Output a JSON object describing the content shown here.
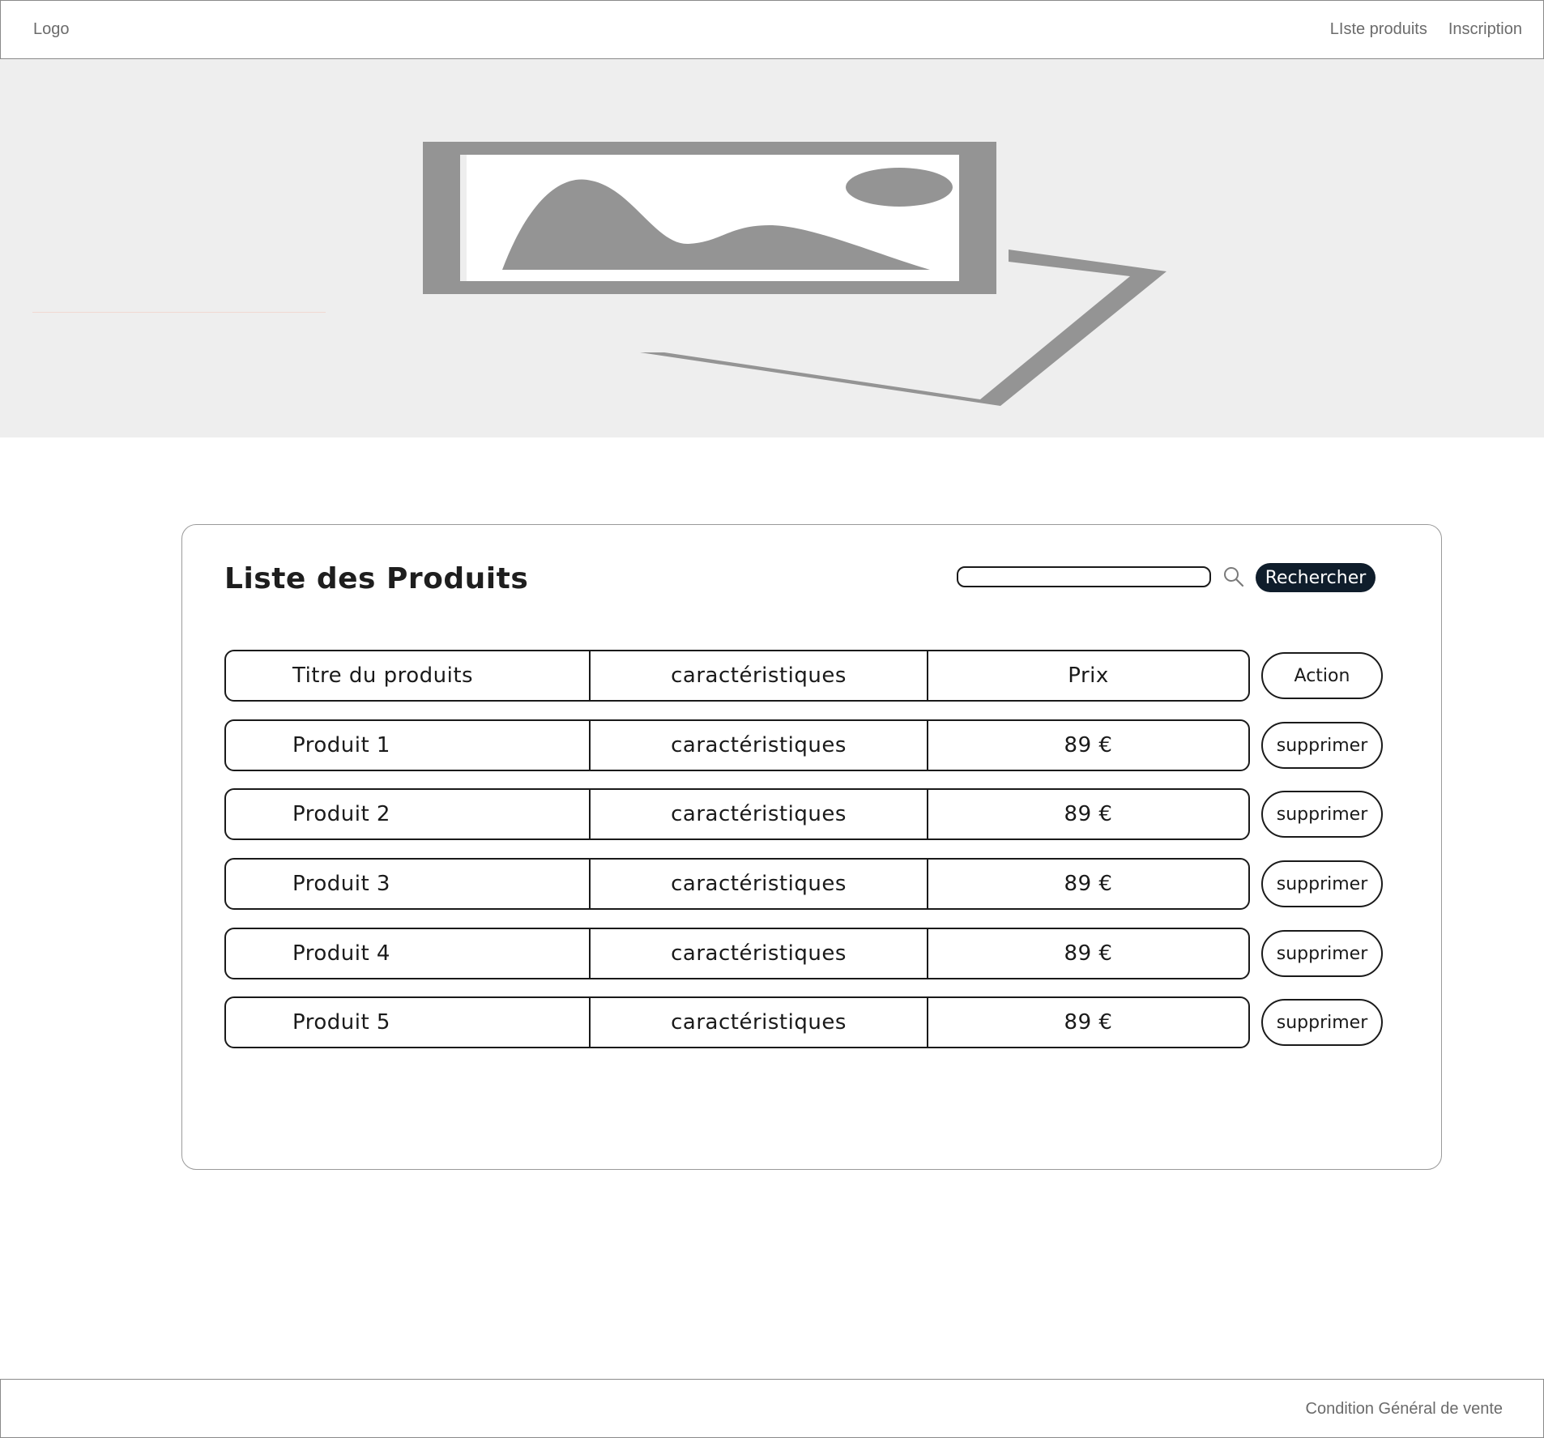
{
  "header": {
    "logo": "Logo",
    "nav": [
      "LIste produits",
      "Inscription"
    ]
  },
  "hero": {
    "image_icon": "image-placeholder-icon"
  },
  "products": {
    "title": "Liste des Produits",
    "search": {
      "placeholder": "",
      "value": "",
      "button_label": "Rechercher",
      "icon": "search-icon"
    },
    "header_row": {
      "title": "Titre du produits",
      "features": "caractéristiques",
      "price": "Prix",
      "action": "Action"
    },
    "rows": [
      {
        "title": "Produit 1",
        "features": "caractéristiques",
        "price": "89 €",
        "action": "supprimer"
      },
      {
        "title": "Produit 2",
        "features": "caractéristiques",
        "price": "89 €",
        "action": "supprimer"
      },
      {
        "title": "Produit 3",
        "features": "caractéristiques",
        "price": "89 €",
        "action": "supprimer"
      },
      {
        "title": "Produit 4",
        "features": "caractéristiques",
        "price": "89 €",
        "action": "supprimer"
      },
      {
        "title": "Produit 5",
        "features": "caractéristiques",
        "price": "89 €",
        "action": "supprimer"
      }
    ]
  },
  "footer": {
    "link": "Condition Général de vente"
  },
  "colors": {
    "hero_bg": "#eeeeee",
    "placeholder_gray": "#949494",
    "search_button_bg": "#0f1d2b",
    "border": "#1a1a1a"
  }
}
